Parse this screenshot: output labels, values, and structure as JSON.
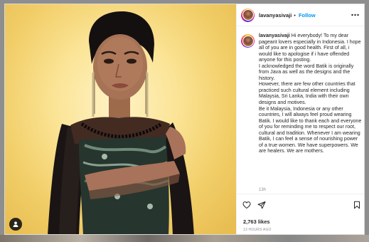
{
  "header": {
    "username": "lavanyasivaji",
    "separator": "•",
    "follow_label": "Follow"
  },
  "caption": {
    "username": "lavanyasivaji",
    "text": " Hi everybody! To my dear pageant lovers especially in Indonesia. I hope all of you are in good health. First of all, i would like to apologise if i have offended anyone for this posting.\nI acknowledged the word Batik is originally from Java as well as the designs and the history.\nHowever, there are few other countries that practiced such cultural element including Malaysia, Sri Lanka, India with their own designs and motives.\nBe it Malaysia, Indonesia or any other countries, I will always feel proud wearing Batik. I would like to thank each and everyone of you for reminding me to respect our root, cultural and tradition. Whenever I am wearing Batik, I can feel a sense of nourishing power of a true women. We have superpowers. We are healers. We are mothers.",
    "time": "13h"
  },
  "stats": {
    "likes": "2,763 likes",
    "date": "13 HOURS AGO"
  },
  "icons": {
    "more": "more-options-icon",
    "like": "heart-icon",
    "share": "send-icon",
    "save": "bookmark-icon",
    "tag": "user-tag-icon"
  },
  "colors": {
    "accent": "#0095f6",
    "text": "#262626",
    "muted": "#8e8e8e",
    "photo_background": "#f7d97a"
  }
}
